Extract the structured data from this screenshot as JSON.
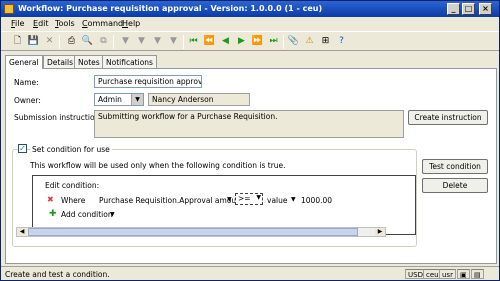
{
  "window": {
    "title": "Workflow: Purchase requisition approval - Version: 1.0.0.0 (1 - ceu)"
  },
  "menu": [
    "File",
    "Edit",
    "Tools",
    "Command",
    "Help"
  ],
  "menu_underline": [
    "F",
    "E",
    "T",
    "C",
    "H"
  ],
  "menu_rest": [
    "ile",
    "dit",
    "ools",
    "ommand",
    "elp"
  ],
  "tabs": [
    "General",
    "Details",
    "Notes",
    "Notifications"
  ],
  "form": {
    "name_label": "Name:",
    "name_value": "Purchase requisition approval",
    "owner_label": "Owner:",
    "owner_value": "Admin",
    "owner_name": "Nancy Anderson",
    "instructions_label": "Submission instructions:",
    "instructions_value": "Submitting workflow for a Purchase Requisition.",
    "create_instruction_btn": "Create instruction",
    "set_condition_label": "Set condition for use",
    "condition_desc": "This workflow will be used only when the following condition is true.",
    "test_condition_btn": "Test condition",
    "delete_btn": "Delete",
    "edit_condition_label": "Edit condition:",
    "where_label": "Where",
    "field_name": "Purchase Requisition.Approval amount",
    "operator": ">=",
    "value_type": "value",
    "value": "1000.00",
    "add_condition_label": "Add condition"
  },
  "status": {
    "message": "Create and test a condition.",
    "currency": "USD",
    "company": "ceu",
    "user": "usr"
  },
  "colors": {
    "title_bar": "#0a3ba8",
    "nav_green": "#1a9a1a"
  }
}
